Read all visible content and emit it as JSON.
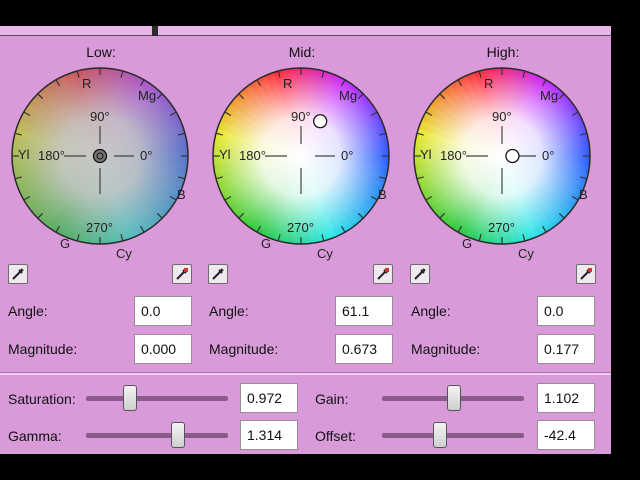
{
  "wheels": [
    {
      "id": "low",
      "title": "Low:",
      "labels": {
        "r": "R",
        "mg": "Mg",
        "yl": "Yl",
        "b": "B",
        "g": "G",
        "cy": "Cy",
        "deg90": "90°",
        "deg180": "180°",
        "deg0": "0°",
        "deg270": "270°"
      },
      "angle_label": "Angle:",
      "angle": "0.0",
      "magnitude_label": "Magnitude:",
      "magnitude": "0.000",
      "marker_angle_deg": 0,
      "marker_magnitude": 0.0
    },
    {
      "id": "mid",
      "title": "Mid:",
      "labels": {
        "r": "R",
        "mg": "Mg",
        "yl": "Yl",
        "b": "B",
        "g": "G",
        "cy": "Cy",
        "deg90": "90°",
        "deg180": "180°",
        "deg0": "0°",
        "deg270": "270°"
      },
      "angle_label": "Angle:",
      "angle": "61.1",
      "magnitude_label": "Magnitude:",
      "magnitude": "0.673",
      "marker_angle_deg": 61.1,
      "marker_magnitude": 0.673
    },
    {
      "id": "high",
      "title": "High:",
      "labels": {
        "r": "R",
        "mg": "Mg",
        "yl": "Yl",
        "b": "B",
        "g": "G",
        "cy": "Cy",
        "deg90": "90°",
        "deg180": "180°",
        "deg0": "0°",
        "deg270": "270°"
      },
      "angle_label": "Angle:",
      "angle": "0.0",
      "magnitude_label": "Magnitude:",
      "magnitude": "0.177",
      "marker_angle_deg": 0,
      "marker_magnitude": 0.177
    }
  ],
  "sliders": {
    "saturation": {
      "label": "Saturation:",
      "value": "0.972",
      "level": 0.31
    },
    "gamma": {
      "label": "Gamma:",
      "value": "1.314",
      "level": 0.65
    },
    "gain": {
      "label": "Gain:",
      "value": "1.102",
      "level": 0.51
    },
    "offset": {
      "label": "Offset:",
      "value": "-42.4",
      "level": 0.41
    }
  },
  "colors": {
    "panel": "#d99ad9",
    "accent": "#8a5a8a"
  },
  "icons": {
    "eyedropper": "eyedropper-icon",
    "marker": "color-marker-icon"
  }
}
